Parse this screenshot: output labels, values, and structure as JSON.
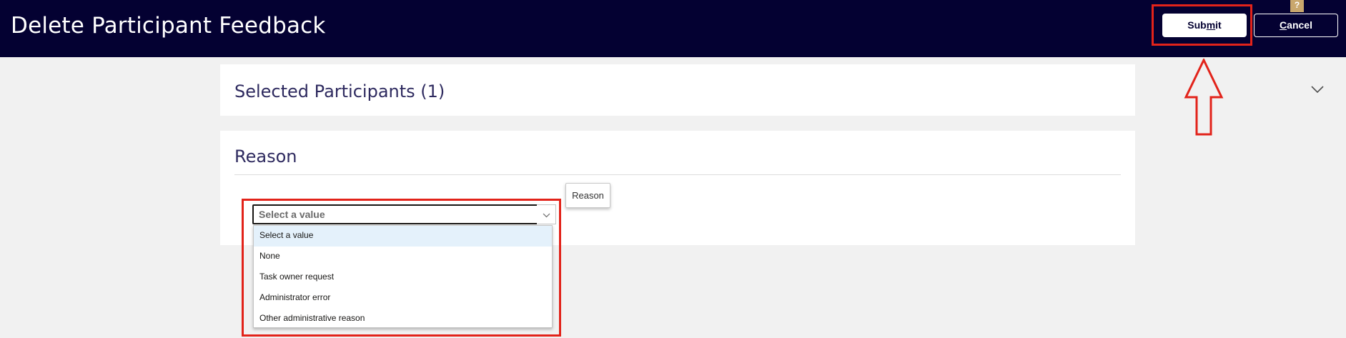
{
  "header": {
    "title": "Delete Participant Feedback",
    "help_label": "?",
    "submit_label_pre": "Sub",
    "submit_label_mnemonic": "m",
    "submit_label_post": "it",
    "cancel_label_mnemonic": "C",
    "cancel_label_post": "ancel"
  },
  "participants": {
    "title": "Selected Participants (1)"
  },
  "reason": {
    "title": "Reason",
    "tooltip": "Reason",
    "select": {
      "current_value": "Select a value",
      "options": [
        "Select a value",
        "None",
        "Task owner request",
        "Administrator error",
        "Other administrative reason"
      ]
    }
  },
  "colors": {
    "header_bg": "#040132",
    "annotation_red": "#e2231a",
    "highlight_option": "#e4f1fb"
  }
}
